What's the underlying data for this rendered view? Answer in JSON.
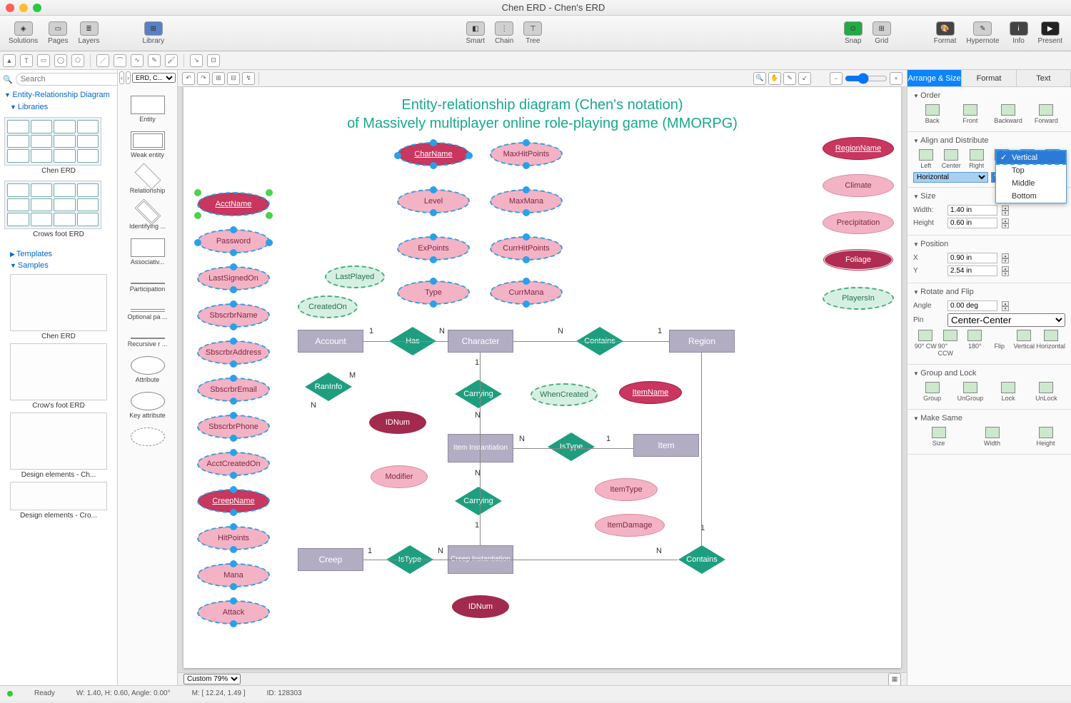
{
  "window": {
    "title": "Chen ERD - Chen's ERD"
  },
  "toolbar": {
    "items": [
      "Solutions",
      "Pages",
      "Layers",
      "Library",
      "Smart",
      "Chain",
      "Tree",
      "Snap",
      "Grid",
      "Format",
      "Hypernote",
      "Info",
      "Present"
    ]
  },
  "sidebar": {
    "search_placeholder": "Search",
    "heading": "Entity-Relationship Diagram",
    "libraries": "Libraries",
    "lib_items": [
      "Chen ERD",
      "Crows foot ERD"
    ],
    "templates": "Templates",
    "samples": "Samples",
    "sample_items": [
      "Chen ERD",
      "Crow's foot ERD",
      "Design elements - Ch...",
      "Design elements - Cro..."
    ]
  },
  "shapes": {
    "tab": "ERD, C...",
    "items": [
      "Entity",
      "Weak entity",
      "Relationship",
      "Identifying ...",
      "Associativ...",
      "Participation",
      "Optional pa ...",
      "Recursive r ...",
      "Attribute",
      "Key attribute"
    ]
  },
  "canvas": {
    "title_line1": "Entity-relationship diagram (Chen's notation)",
    "title_line2": "of Massively multiplayer online role-playing game (MMORPG)",
    "attributes_left": [
      "AcctName",
      "Password",
      "LastSignedOn",
      "SbscrbrName",
      "SbscrbrAddress",
      "SbscrbrEmail",
      "SbscrbrPhone",
      "AcctCreatedOn",
      "CreepName",
      "HitPoints",
      "Mana",
      "Attack"
    ],
    "attributes_col2": [
      "CharName",
      "Level",
      "ExPoints",
      "Type"
    ],
    "attributes_col3": [
      "MaxHitPoints",
      "MaxMana",
      "CurrHitPoints",
      "CurrMana"
    ],
    "attributes_right": [
      "RegionName",
      "Climate",
      "Precipitation",
      "Foliage",
      "PlayersIn"
    ],
    "derived": [
      "LastPlayed",
      "CreatedOn",
      "WhenCreated"
    ],
    "entities": [
      "Account",
      "Character",
      "Region",
      "Item Instantiation",
      "Item",
      "Creep",
      "Creep Instantiation"
    ],
    "relationships": [
      "Has",
      "Contains",
      "RanInfo",
      "Carrying",
      "IsType",
      "Carrying",
      "IsType",
      "Contains"
    ],
    "misc_attrs": [
      "IDNum",
      "Modifier",
      "ItemName",
      "ItemType",
      "ItemDamage",
      "IDNum"
    ],
    "cardinalities": {
      "one": "1",
      "n": "N",
      "m": "M"
    }
  },
  "inspector": {
    "tabs": [
      "Arrange & Size",
      "Format",
      "Text"
    ],
    "order": {
      "label": "Order",
      "items": [
        "Back",
        "Front",
        "Backward",
        "Forward"
      ]
    },
    "align": {
      "label": "Align and Distribute",
      "items": [
        "Left",
        "Center",
        "Right",
        "Top",
        "Middle",
        "Bottom"
      ],
      "sel_h": "Horizontal",
      "sel_v": "Vertical"
    },
    "size": {
      "label": "Size",
      "width_label": "Width:",
      "width": "1.40 in",
      "height_label": "Height",
      "height": "0.60 in"
    },
    "position": {
      "label": "Position",
      "x_label": "X",
      "x": "0.90 in",
      "y_label": "Y",
      "y": "2.54 in"
    },
    "rotate": {
      "label": "Rotate and Flip",
      "angle_label": "Angle",
      "angle": "0.00 deg",
      "pin_label": "Pin",
      "pin": "Center-Center",
      "items": [
        "90° CW",
        "90° CCW",
        "180°",
        "Flip",
        "Vertical",
        "Horizontal"
      ]
    },
    "group": {
      "label": "Group and Lock",
      "items": [
        "Group",
        "UnGroup",
        "Lock",
        "UnLock"
      ]
    },
    "makesame": {
      "label": "Make Same",
      "items": [
        "Size",
        "Width",
        "Height"
      ]
    },
    "dropdown": [
      "Vertical",
      "Top",
      "Middle",
      "Bottom"
    ]
  },
  "bottombar": {
    "zoom": "Custom 79%"
  },
  "status": {
    "ready": "Ready",
    "wh": "W: 1.40,  H: 0.60,  Angle: 0.00°",
    "mouse": "M: [ 12.24, 1.49 ]",
    "id": "ID: 128303"
  }
}
